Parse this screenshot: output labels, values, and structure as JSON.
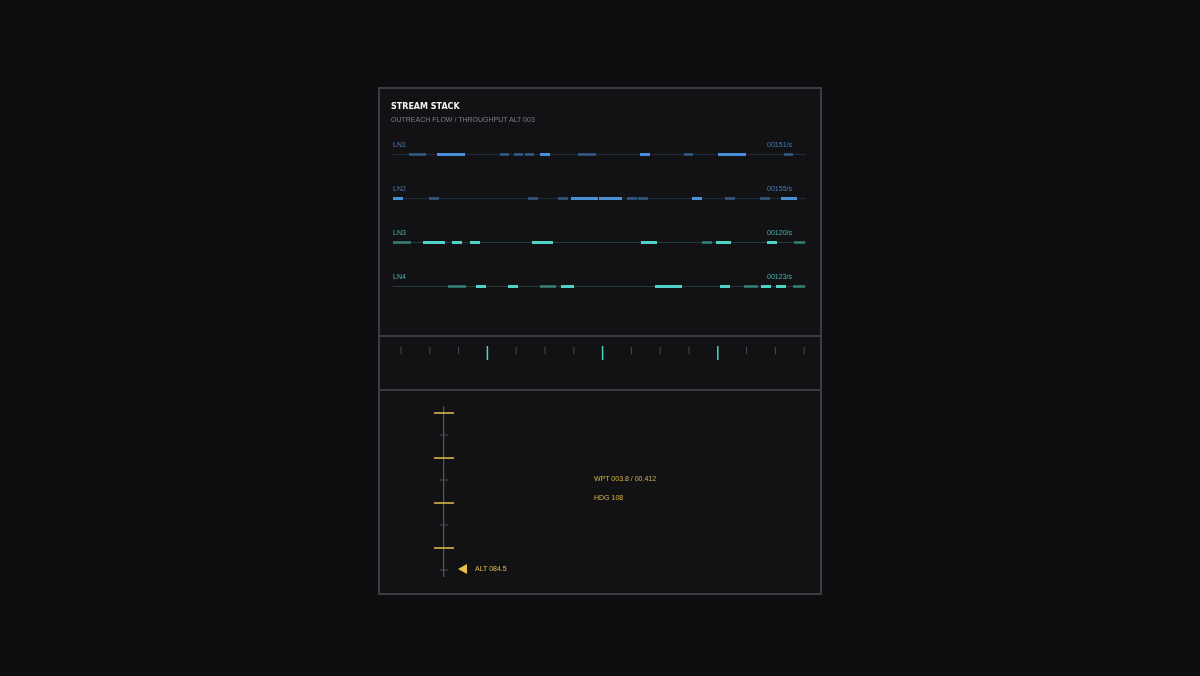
{
  "header": {
    "title": "STREAM STACK",
    "subtitle": "OUTREACH FLOW / THROUGHPUT ALT 003"
  },
  "streams": [
    {
      "label": "LN1",
      "rate": "00151/s",
      "color": "#4a90d9"
    },
    {
      "label": "LN2",
      "rate": "00155/s",
      "color": "#4a90d9"
    },
    {
      "label": "LN3",
      "rate": "00120/s",
      "color": "#4fd1c5"
    },
    {
      "label": "LN4",
      "rate": "00123/s",
      "color": "#4fd1c5"
    }
  ],
  "altitude": {
    "reading": "ALT 084.5"
  },
  "readouts": [
    {
      "text": "WPT 003.8 / 00.412"
    },
    {
      "text": "HDG 108"
    }
  ]
}
